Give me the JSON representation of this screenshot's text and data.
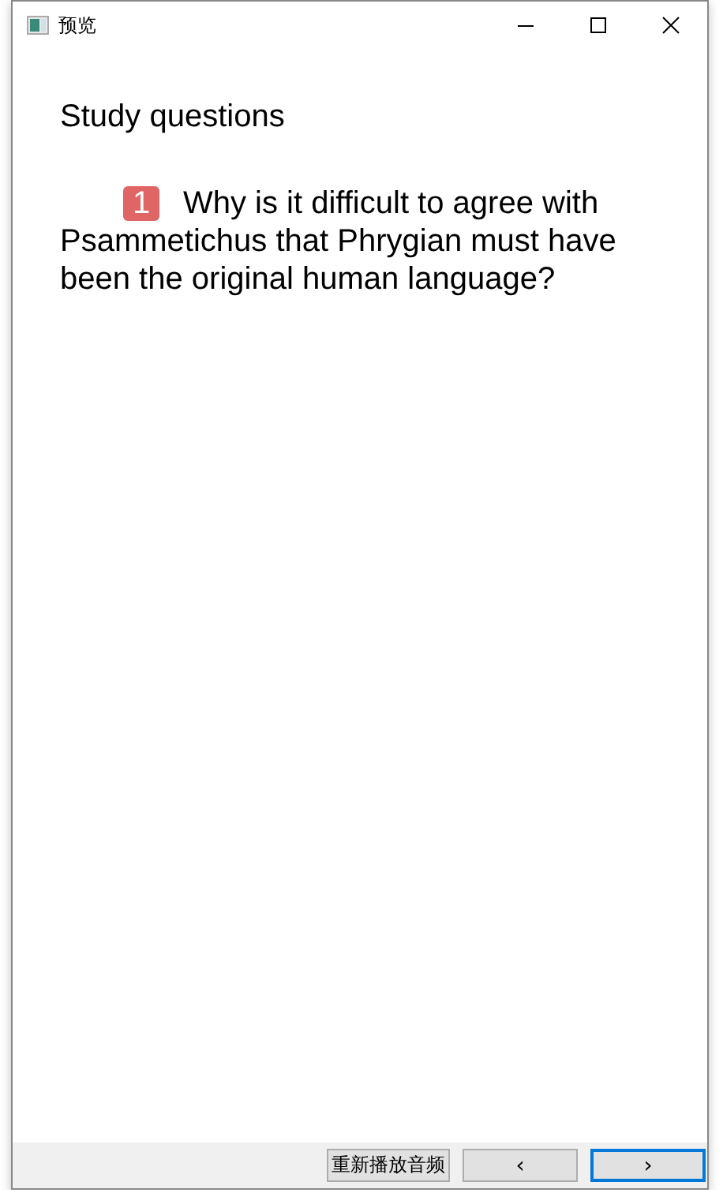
{
  "window": {
    "title": "预览"
  },
  "heading": "Study questions",
  "questions": [
    {
      "number": "1",
      "text": "Why is it difficult to agree with Psammetichus that Phrygian must have been the original human language?"
    }
  ],
  "buttons": [
    {
      "label": "重新播放音频",
      "kind": "text",
      "focused": false
    },
    {
      "label": "‹",
      "kind": "nav",
      "focused": false
    },
    {
      "label": "›",
      "kind": "nav",
      "focused": true
    }
  ]
}
